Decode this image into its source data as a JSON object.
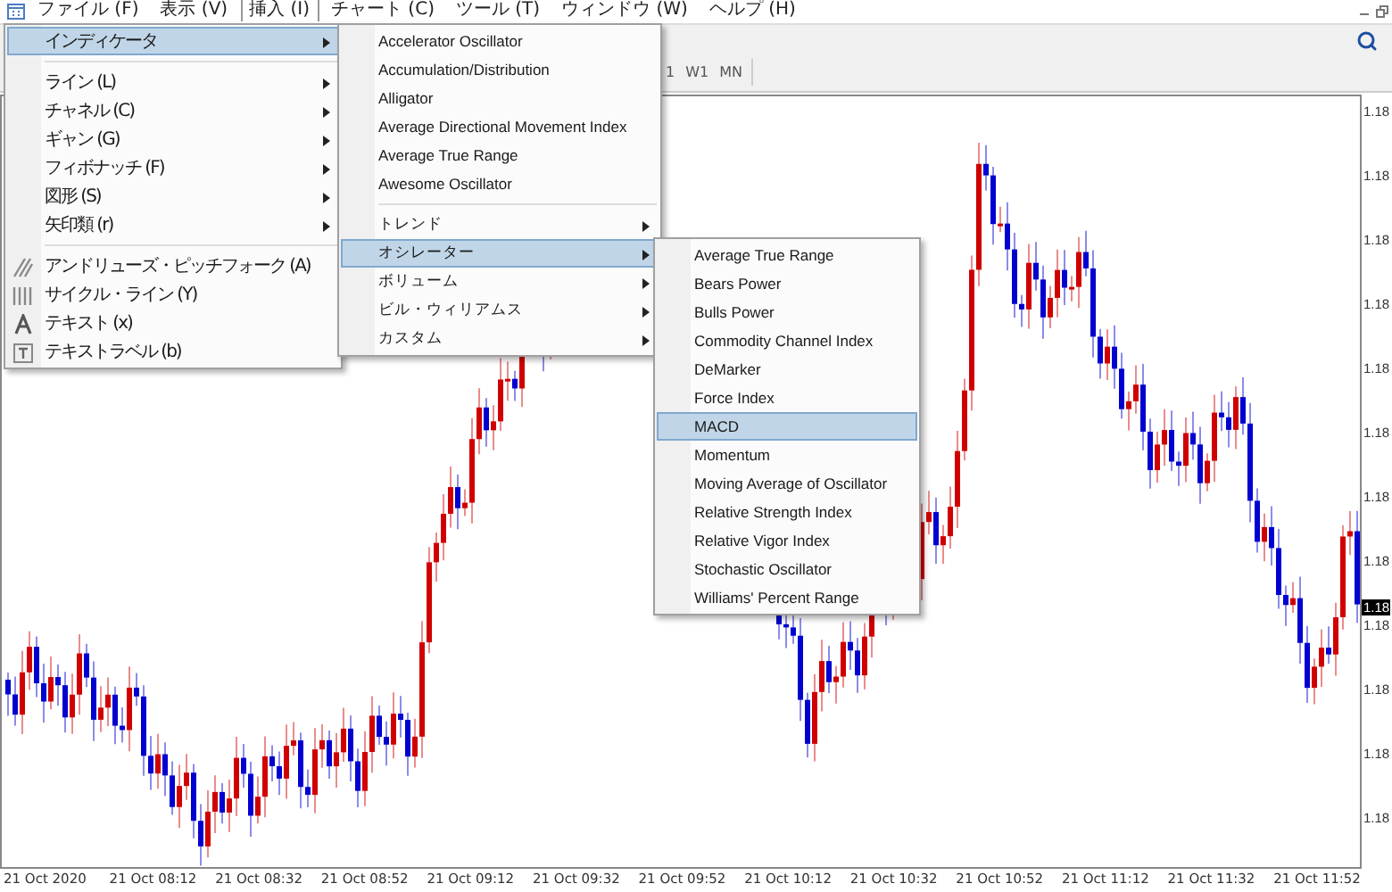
{
  "menubar": {
    "items": [
      {
        "label": "ファイル (F)",
        "selected": false
      },
      {
        "label": "表示 (V)",
        "selected": false
      },
      {
        "label": "挿入 (I)",
        "selected": true
      },
      {
        "label": "チャート (C)",
        "selected": false
      },
      {
        "label": "ツール (T)",
        "selected": false
      },
      {
        "label": "ウィンドウ (W)",
        "selected": false
      },
      {
        "label": "ヘルプ (H)",
        "selected": false
      }
    ]
  },
  "toolbar": {
    "timeframes": [
      "1",
      "W1",
      "MN"
    ]
  },
  "insert_menu": {
    "sections": [
      [
        {
          "label": "インディケータ",
          "selected": true,
          "has_submenu": true
        }
      ],
      [
        {
          "label": "ライン (L)",
          "selected": false,
          "has_submenu": true
        },
        {
          "label": "チャネル (C)",
          "selected": false,
          "has_submenu": true
        },
        {
          "label": "ギャン (G)",
          "selected": false,
          "has_submenu": true
        },
        {
          "label": "フィボナッチ (F)",
          "selected": false,
          "has_submenu": true
        },
        {
          "label": "図形 (S)",
          "selected": false,
          "has_submenu": true
        },
        {
          "label": "矢印類 (r)",
          "selected": false,
          "has_submenu": true
        }
      ],
      [
        {
          "label": "アンドリューズ・ピッチフォーク (A)",
          "selected": false,
          "has_submenu": false
        },
        {
          "label": "サイクル・ライン (Y)",
          "selected": false,
          "has_submenu": false
        },
        {
          "label": "テキスト (x)",
          "selected": false,
          "has_submenu": false
        },
        {
          "label": "テキストラベル (b)",
          "selected": false,
          "has_submenu": false
        }
      ]
    ]
  },
  "indicator_menu": {
    "sections": [
      [
        {
          "label": "Accelerator Oscillator",
          "selected": false,
          "has_submenu": false
        },
        {
          "label": "Accumulation/Distribution",
          "selected": false,
          "has_submenu": false
        },
        {
          "label": "Alligator",
          "selected": false,
          "has_submenu": false
        },
        {
          "label": "Average Directional Movement Index",
          "selected": false,
          "has_submenu": false
        },
        {
          "label": "Average True Range",
          "selected": false,
          "has_submenu": false
        },
        {
          "label": "Awesome Oscillator",
          "selected": false,
          "has_submenu": false
        }
      ],
      [
        {
          "label": "トレンド",
          "selected": false,
          "has_submenu": true
        },
        {
          "label": "オシレーター",
          "selected": true,
          "has_submenu": true
        },
        {
          "label": "ボリューム",
          "selected": false,
          "has_submenu": true
        },
        {
          "label": "ビル・ウィリアムス",
          "selected": false,
          "has_submenu": true
        },
        {
          "label": "カスタム",
          "selected": false,
          "has_submenu": true
        }
      ]
    ]
  },
  "oscillator_menu": {
    "sections": [
      [
        {
          "label": "Average True Range",
          "selected": false,
          "has_submenu": false
        },
        {
          "label": "Bears Power",
          "selected": false,
          "has_submenu": false
        },
        {
          "label": "Bulls Power",
          "selected": false,
          "has_submenu": false
        },
        {
          "label": "Commodity Channel Index",
          "selected": false,
          "has_submenu": false
        },
        {
          "label": "DeMarker",
          "selected": false,
          "has_submenu": false
        },
        {
          "label": "Force Index",
          "selected": false,
          "has_submenu": false
        },
        {
          "label": "MACD",
          "selected": true,
          "has_submenu": false
        },
        {
          "label": "Momentum",
          "selected": false,
          "has_submenu": false
        },
        {
          "label": "Moving Average of Oscillator",
          "selected": false,
          "has_submenu": false
        },
        {
          "label": "Relative Strength Index",
          "selected": false,
          "has_submenu": false
        },
        {
          "label": "Relative Vigor Index",
          "selected": false,
          "has_submenu": false
        },
        {
          "label": "Stochastic Oscillator",
          "selected": false,
          "has_submenu": false
        },
        {
          "label": "Williams' Percent Range",
          "selected": false,
          "has_submenu": false
        }
      ]
    ]
  },
  "chart": {
    "price_labels": [
      "1.18",
      "1.18",
      "1.18",
      "1.18",
      "1.18",
      "1.18",
      "1.18",
      "1.18",
      "1.18",
      "1.18",
      "1.18",
      "1.18"
    ],
    "current_price": "1.18",
    "time_labels": [
      "21 Oct 2020",
      "21 Oct 08:12",
      "21 Oct 08:32",
      "21 Oct 08:52",
      "21 Oct 09:12",
      "21 Oct 09:32",
      "21 Oct 09:52",
      "21 Oct 10:12",
      "21 Oct 10:32",
      "21 Oct 10:52",
      "21 Oct 11:12",
      "21 Oct 11:32",
      "21 Oct 11:52"
    ]
  }
}
